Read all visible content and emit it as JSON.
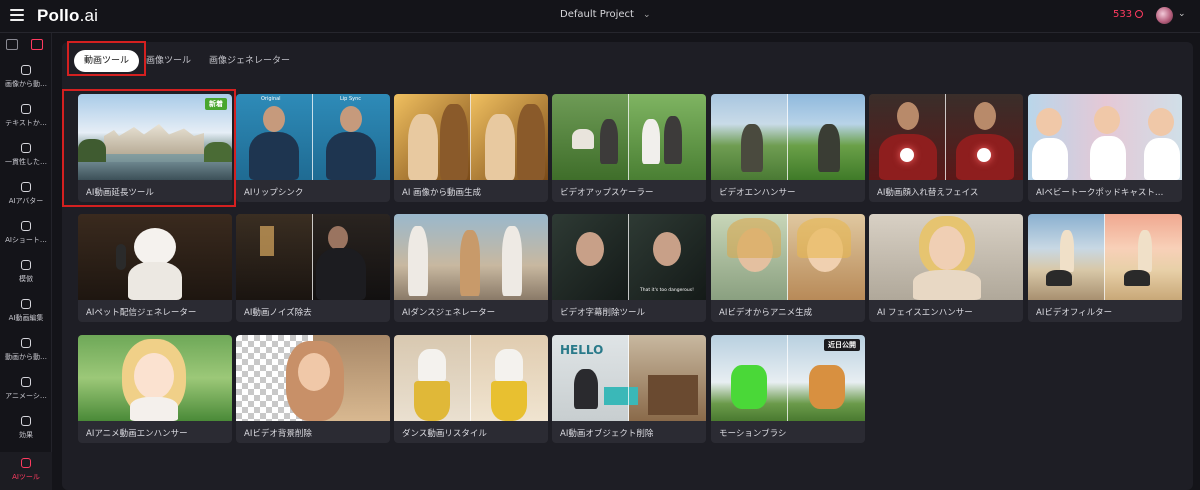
{
  "header": {
    "logo_main": "Pollo",
    "logo_suffix": ".ai",
    "project": "Default Project",
    "credits": "533"
  },
  "icons": {
    "menu": "hamburger-icon",
    "project_dropdown": "chevron-down-icon",
    "credits": "coin-icon",
    "profile_dropdown": "chevron-down-icon"
  },
  "sidebar": {
    "mode_tabs": [
      "image-mode-icon",
      "video-mode-icon"
    ],
    "items": [
      {
        "label": "画像から動…",
        "icon": "image-to-video-icon"
      },
      {
        "label": "テキストか…",
        "icon": "text-to-video-icon"
      },
      {
        "label": "一貫性した…",
        "icon": "consistent-video-icon"
      },
      {
        "label": "AIアバター",
        "icon": "avatar-icon"
      },
      {
        "label": "AIショート…",
        "icon": "short-video-icon"
      },
      {
        "label": "模倣",
        "icon": "mimic-icon"
      },
      {
        "label": "AI動画編集",
        "icon": "video-edit-icon"
      },
      {
        "label": "動画から動…",
        "icon": "video-to-video-icon"
      },
      {
        "label": "アニメーシ…",
        "icon": "animation-icon"
      },
      {
        "label": "効果",
        "icon": "effects-icon"
      },
      {
        "label": "AIツール",
        "icon": "ai-tools-icon",
        "active": true
      }
    ]
  },
  "tabs": [
    {
      "label": "動画ツール",
      "active": true
    },
    {
      "label": "画像ツール",
      "active": false
    },
    {
      "label": "画像ジェネレーター",
      "active": false
    }
  ],
  "cards": [
    {
      "label": "AI動画延長ツール",
      "badge": "新着"
    },
    {
      "label": "AIリップシンク",
      "tags": [
        "Original",
        "Lip Sync"
      ]
    },
    {
      "label": "AI 画像から動画生成"
    },
    {
      "label": "ビデオアップスケーラー"
    },
    {
      "label": "ビデオエンハンサー"
    },
    {
      "label": "AI動画顔入れ替えフェイス"
    },
    {
      "label": "AIベビートークポッドキャスト…"
    },
    {
      "label": "AIペット配信ジェネレーター"
    },
    {
      "label": "AI動画ノイズ除去"
    },
    {
      "label": "AIダンスジェネレーター"
    },
    {
      "label": "ビデオ字幕削除ツール",
      "caption": "That it's too dangerous!"
    },
    {
      "label": "AIビデオからアニメ生成"
    },
    {
      "label": "AI フェイスエンハンサー"
    },
    {
      "label": "AIビデオフィルター"
    },
    {
      "label": "AIアニメ動画エンハンサー"
    },
    {
      "label": "AIビデオ背景削除"
    },
    {
      "label": "ダンス動画リスタイル"
    },
    {
      "label": "AI動画オブジェクト削除",
      "sign": "HELLO"
    },
    {
      "label": "モーションブラシ",
      "badge": "近日公開"
    }
  ]
}
